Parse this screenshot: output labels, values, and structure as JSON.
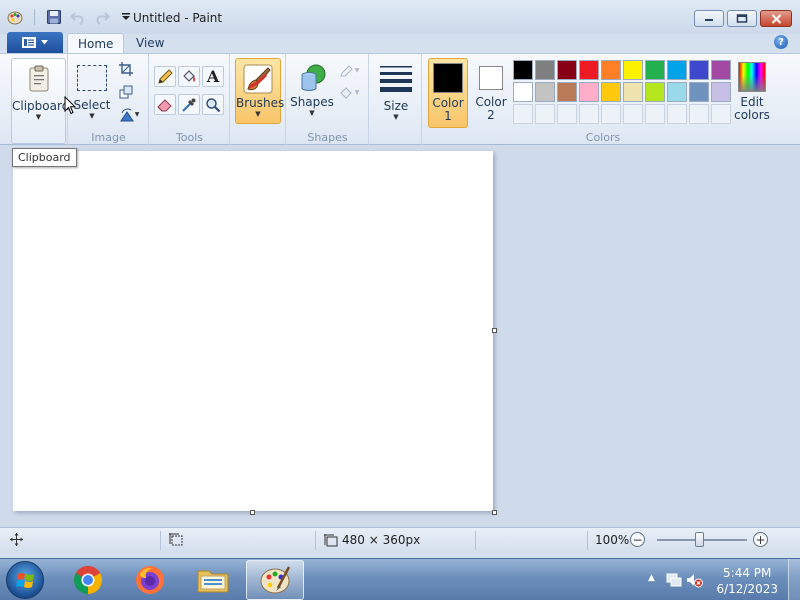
{
  "window": {
    "title": "Untitled - Paint"
  },
  "tabs": [
    {
      "label": "Home"
    },
    {
      "label": "View"
    }
  ],
  "help_glyph": "?",
  "ribbon": {
    "clipboard": {
      "label": "Clipboard"
    },
    "image": {
      "select_label": "Select",
      "group_label": "Image"
    },
    "tools": {
      "group_label": "Tools"
    },
    "brushes": {
      "label": "Brushes"
    },
    "shapes": {
      "label": "Shapes",
      "group_label": "Shapes"
    },
    "size": {
      "label": "Size"
    },
    "color1": {
      "label_line1": "Color",
      "label_line2": "1"
    },
    "color2": {
      "label_line1": "Color",
      "label_line2": "2"
    },
    "colors": {
      "group_label": "Colors"
    },
    "edit_colors": {
      "label_line1": "Edit",
      "label_line2": "colors"
    },
    "palette_row1": [
      "#000000",
      "#7f7f7f",
      "#880015",
      "#ed1c24",
      "#ff7f27",
      "#fff200",
      "#22b14c",
      "#00a2e8",
      "#3f48cc",
      "#a349a4"
    ],
    "palette_row2": [
      "#ffffff",
      "#c3c3c3",
      "#b97a57",
      "#ffaec9",
      "#ffc90e",
      "#efe4b0",
      "#b5e61d",
      "#99d9ea",
      "#7092be",
      "#c8bfe7"
    ],
    "color1_value": "#000000",
    "color2_value": "#ffffff"
  },
  "tooltip": {
    "text": "Clipboard"
  },
  "statusbar": {
    "image_size": "480 × 360px",
    "zoom": "100%",
    "zoom_out": "−",
    "zoom_in": "+"
  },
  "taskbar": {
    "time": "5:44 PM",
    "date": "6/12/2023"
  }
}
